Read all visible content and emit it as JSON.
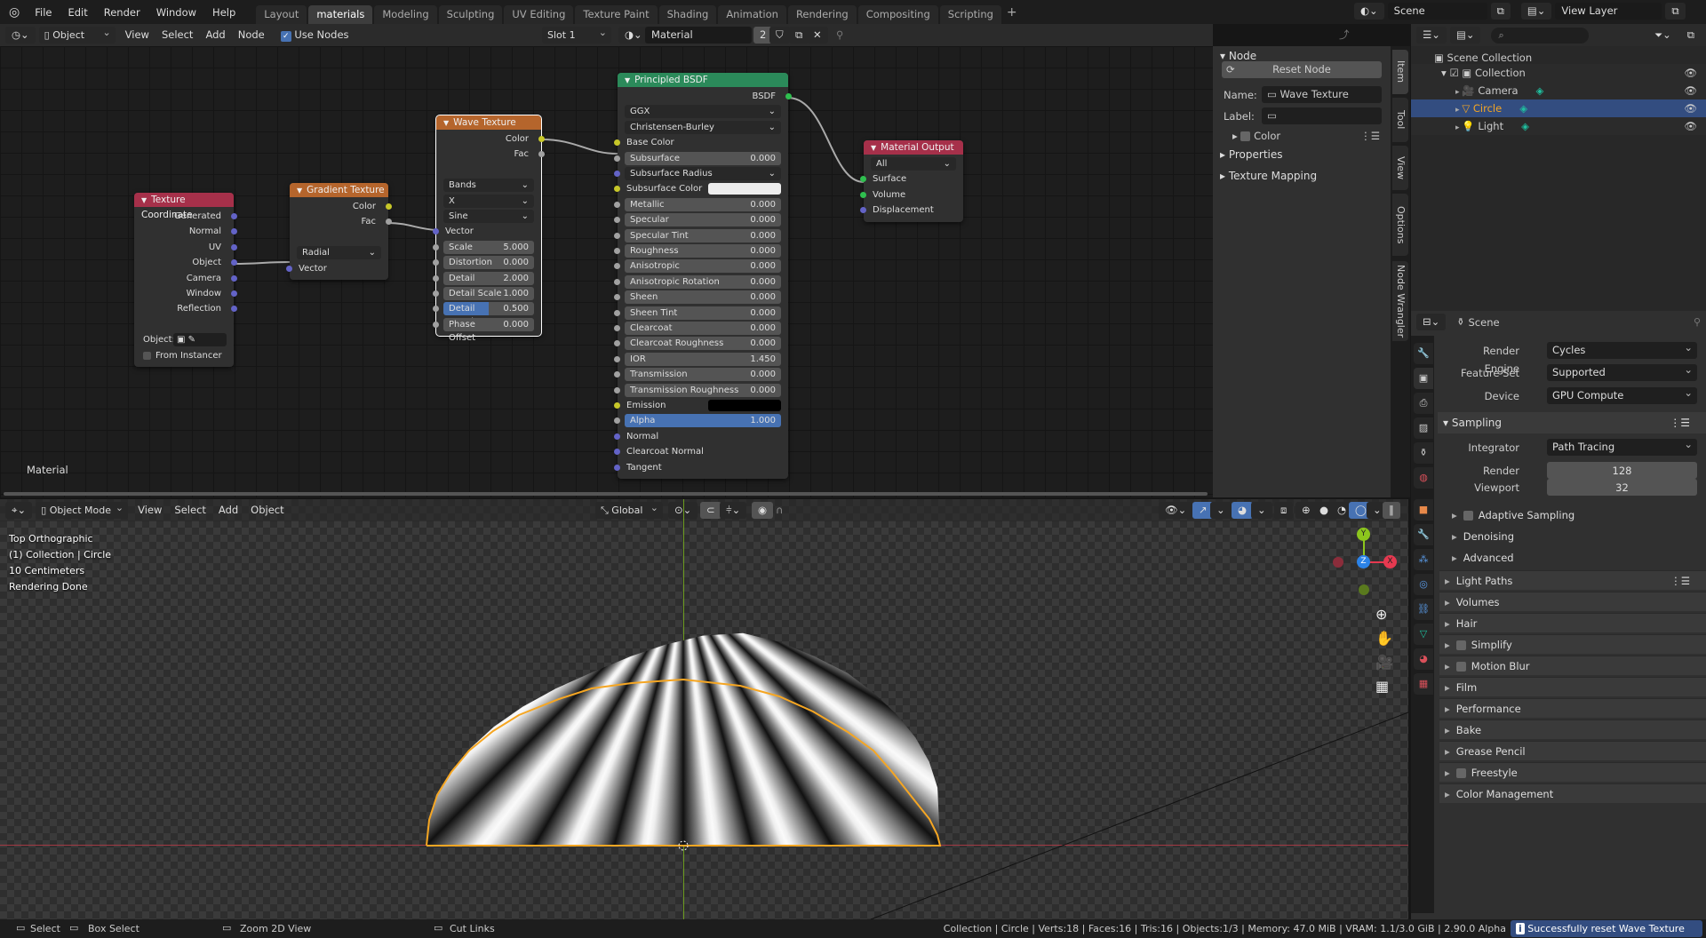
{
  "topbar": {
    "menus": [
      "File",
      "Edit",
      "Render",
      "Window",
      "Help"
    ],
    "workspaces": [
      "Layout",
      "materials",
      "Modeling",
      "Sculpting",
      "UV Editing",
      "Texture Paint",
      "Shading",
      "Animation",
      "Rendering",
      "Compositing",
      "Scripting"
    ],
    "active_workspace": "materials",
    "add_tab": "+",
    "scene": "Scene",
    "view_layer": "View Layer"
  },
  "node_header": {
    "mode": "Object",
    "menus": [
      "View",
      "Select",
      "Add",
      "Node"
    ],
    "use_nodes": "Use Nodes",
    "use_nodes_checked": true,
    "slot": "Slot 1",
    "material": "Material",
    "users": "2"
  },
  "node_editor": {
    "material_label": "Material",
    "nodes": [
      {
        "id": "texcoord",
        "title": "Texture Coordinate",
        "color": "#a6304a",
        "rows": [
          {
            "t": "out",
            "l": "Generated",
            "s": "#6363c7"
          },
          {
            "t": "out",
            "l": "Normal",
            "s": "#6363c7"
          },
          {
            "t": "out",
            "l": "UV",
            "s": "#6363c7"
          },
          {
            "t": "out",
            "l": "Object",
            "s": "#6363c7"
          },
          {
            "t": "out",
            "l": "Camera",
            "s": "#6363c7"
          },
          {
            "t": "out",
            "l": "Window",
            "s": "#6363c7"
          },
          {
            "t": "out",
            "l": "Reflection",
            "s": "#6363c7"
          },
          {
            "t": "gap"
          },
          {
            "t": "obj",
            "l": "Object:"
          },
          {
            "t": "chk",
            "l": "From Instancer"
          }
        ]
      },
      {
        "id": "gradient",
        "title": "Gradient Texture",
        "color": "#b5652c",
        "rows": [
          {
            "t": "out",
            "l": "Color",
            "s": "#c7c729"
          },
          {
            "t": "out",
            "l": "Fac",
            "s": "#a1a1a1"
          },
          {
            "t": "gap"
          },
          {
            "t": "dd",
            "l": "Radial"
          },
          {
            "t": "in",
            "l": "Vector",
            "s": "#6363c7"
          }
        ]
      },
      {
        "id": "wave",
        "title": "Wave Texture",
        "color": "#b5652c",
        "selected": true,
        "rows": [
          {
            "t": "out",
            "l": "Color",
            "s": "#c7c729"
          },
          {
            "t": "out",
            "l": "Fac",
            "s": "#a1a1a1"
          },
          {
            "t": "gap"
          },
          {
            "t": "dd",
            "l": "Bands"
          },
          {
            "t": "dd",
            "l": "X"
          },
          {
            "t": "dd",
            "l": "Sine"
          },
          {
            "t": "in",
            "l": "Vector",
            "s": "#6363c7"
          },
          {
            "t": "num",
            "l": "Scale",
            "v": "5.000"
          },
          {
            "t": "num",
            "l": "Distortion",
            "v": "0.000"
          },
          {
            "t": "num",
            "l": "Detail",
            "v": "2.000"
          },
          {
            "t": "num",
            "l": "Detail Scale",
            "v": "1.000"
          },
          {
            "t": "num",
            "l": "Detail Roughne",
            "v": "0.500",
            "fill": 0.5
          },
          {
            "t": "num",
            "l": "Phase Offset",
            "v": "0.000"
          }
        ]
      },
      {
        "id": "bsdf",
        "title": "Principled BSDF",
        "color": "#2b8a5a",
        "rows": [
          {
            "t": "out",
            "l": "BSDF",
            "s": "#2fbf4f"
          },
          {
            "t": "dd",
            "l": "GGX"
          },
          {
            "t": "dd",
            "l": "Christensen-Burley"
          },
          {
            "t": "in",
            "l": "Base Color",
            "s": "#c7c729"
          },
          {
            "t": "num",
            "l": "Subsurface",
            "v": "0.000"
          },
          {
            "t": "ddin",
            "l": "Subsurface Radius",
            "s": "#6363c7"
          },
          {
            "t": "col",
            "l": "Subsurface Color",
            "s": "#c7c729",
            "c": "#eeeeee"
          },
          {
            "t": "num",
            "l": "Metallic",
            "v": "0.000"
          },
          {
            "t": "num",
            "l": "Specular",
            "v": "0.000"
          },
          {
            "t": "num",
            "l": "Specular Tint",
            "v": "0.000"
          },
          {
            "t": "num",
            "l": "Roughness",
            "v": "0.000"
          },
          {
            "t": "num",
            "l": "Anisotropic",
            "v": "0.000"
          },
          {
            "t": "num",
            "l": "Anisotropic Rotation",
            "v": "0.000"
          },
          {
            "t": "num",
            "l": "Sheen",
            "v": "0.000"
          },
          {
            "t": "num",
            "l": "Sheen Tint",
            "v": "0.000"
          },
          {
            "t": "num",
            "l": "Clearcoat",
            "v": "0.000"
          },
          {
            "t": "num",
            "l": "Clearcoat Roughness",
            "v": "0.000"
          },
          {
            "t": "num",
            "l": "IOR",
            "v": "1.450"
          },
          {
            "t": "num",
            "l": "Transmission",
            "v": "0.000"
          },
          {
            "t": "num",
            "l": "Transmission Roughness",
            "v": "0.000"
          },
          {
            "t": "col",
            "l": "Emission",
            "s": "#c7c729",
            "c": "#000000"
          },
          {
            "t": "num",
            "l": "Alpha",
            "v": "1.000",
            "fill": 1
          },
          {
            "t": "in",
            "l": "Normal",
            "s": "#6363c7"
          },
          {
            "t": "in",
            "l": "Clearcoat Normal",
            "s": "#6363c7"
          },
          {
            "t": "in",
            "l": "Tangent",
            "s": "#6363c7"
          }
        ]
      },
      {
        "id": "output",
        "title": "Material Output",
        "color": "#a6304a",
        "rows": [
          {
            "t": "dd",
            "l": "All"
          },
          {
            "t": "in",
            "l": "Surface",
            "s": "#2fbf4f"
          },
          {
            "t": "in",
            "l": "Volume",
            "s": "#2fbf4f"
          },
          {
            "t": "in",
            "l": "Displacement",
            "s": "#6363c7"
          }
        ]
      }
    ]
  },
  "npanel": {
    "section": "Node",
    "reset": "Reset Node",
    "name_label": "Name:",
    "name_value": "Wave Texture",
    "label_label": "Label:",
    "label_value": "",
    "color": "Color",
    "properties": "Properties",
    "texture_mapping": "Texture Mapping",
    "tabs": [
      "Item",
      "Tool",
      "View",
      "Options",
      "Node Wrangler"
    ]
  },
  "outliner": {
    "root": "Scene Collection",
    "collection": "Collection",
    "items": [
      {
        "name": "Camera",
        "icon": "camera-icon"
      },
      {
        "name": "Circle",
        "icon": "mesh-icon",
        "selected": true
      },
      {
        "name": "Light",
        "icon": "light-icon"
      }
    ]
  },
  "properties": {
    "context": "Scene",
    "render_engine_label": "Render Engine",
    "render_engine": "Cycles",
    "feature_set_label": "Feature Set",
    "feature_set": "Supported",
    "device_label": "Device",
    "device": "GPU Compute",
    "sampling": "Sampling",
    "integrator_label": "Integrator",
    "integrator": "Path Tracing",
    "render_label": "Render",
    "render_samples": "128",
    "viewport_label": "Viewport",
    "viewport_samples": "32",
    "sub_sections": [
      "Adaptive Sampling",
      "Denoising",
      "Advanced"
    ],
    "sections": [
      "Light Paths",
      "Volumes",
      "Hair",
      "Simplify",
      "Motion Blur",
      "Film",
      "Performance",
      "Bake",
      "Grease Pencil",
      "Freestyle",
      "Color Management"
    ]
  },
  "viewport": {
    "mode": "Object Mode",
    "menus": [
      "View",
      "Select",
      "Add",
      "Object"
    ],
    "orientation": "Global",
    "overlay_text": [
      "Top Orthographic",
      "(1) Collection | Circle",
      "10 Centimeters",
      "Rendering Done"
    ],
    "gizmo": {
      "x": "X",
      "y": "Y",
      "z": "Z"
    }
  },
  "statusbar": {
    "hints": [
      "Select",
      "Box Select",
      "Zoom 2D View",
      "Cut Links"
    ],
    "stats": "Collection | Circle | Verts:18 | Faces:16 | Tris:16 | Objects:1/3 | Memory: 47.0 MiB | VRAM: 1.1/3.0 GiB | 2.90.0 Alpha",
    "report": "Successfully reset Wave Texture"
  },
  "colors": {
    "accent": "#4772b3",
    "selection": "#334d80",
    "object_orange": "#f5a623"
  }
}
